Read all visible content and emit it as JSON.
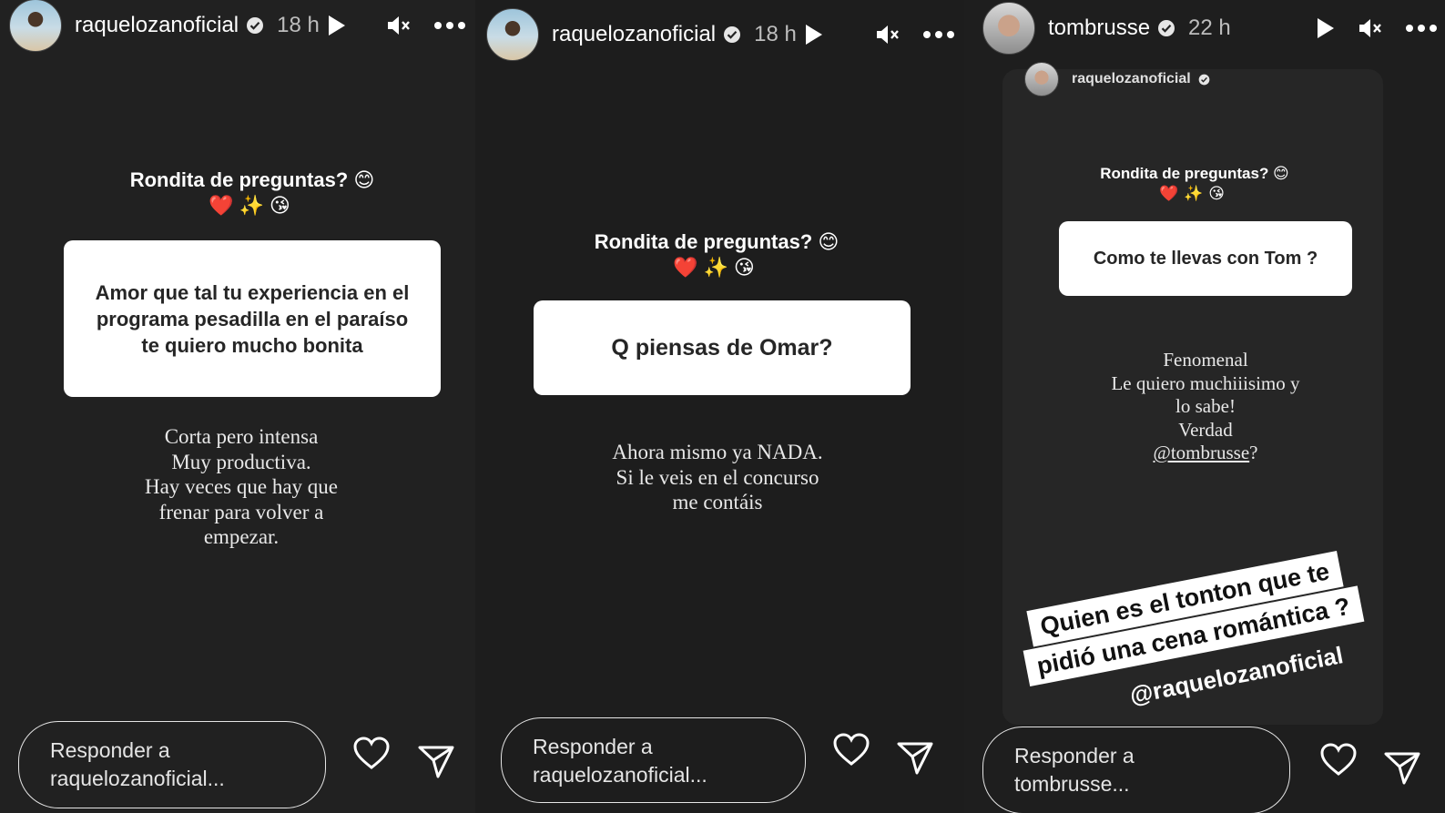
{
  "stories": [
    {
      "username": "raquelozanoficial",
      "time": "18 h",
      "sticker_title": "Rondita de preguntas? 😊",
      "sticker_emojis": "❤️✨😘",
      "question": "Amor que tal tu experiencia en el programa pesadilla en el paraíso te quiero mucho bonita",
      "answer_lines": [
        "Corta pero intensa",
        "Muy productiva.",
        "Hay veces que hay que",
        "frenar para volver a",
        "empezar."
      ],
      "reply_lines": [
        "Responder a",
        "raquelozanoficial..."
      ]
    },
    {
      "username": "raquelozanoficial",
      "time": "18 h",
      "sticker_title": "Rondita de preguntas? 😊",
      "sticker_emojis": "❤️✨😘",
      "question": "Q piensas de Omar?",
      "answer_lines": [
        "Ahora mismo ya NADA.",
        "Si le veis en el concurso",
        "me contáis"
      ],
      "reply_lines": [
        "Responder a",
        "raquelozanoficial..."
      ]
    },
    {
      "username": "tombrusse",
      "time": "22 h",
      "repost_username": "raquelozanoficial",
      "sticker_title": "Rondita de preguntas? 😊",
      "sticker_emojis": "❤️✨😘",
      "question": "Como te llevas con Tom ?",
      "answer_lines": [
        "Fenomenal",
        "Le quiero muchiiisimo y",
        "lo sabe!",
        "Verdad"
      ],
      "answer_mention": "@tombrusse",
      "answer_mention_suffix": "?",
      "caption_line1": "Quien es el tonton que te",
      "caption_line2": "pidió una cena romántica ?",
      "caption_mention": "@raquelozanoficial",
      "reply_lines": [
        "Responder a",
        "tombrusse..."
      ]
    }
  ],
  "icons": [
    "play-icon",
    "mute-icon",
    "more-icon",
    "verified-icon",
    "heart-icon",
    "send-icon"
  ],
  "colors": {
    "background": "#1f1f1f",
    "card": "#ffffff",
    "heart": "#e0245e"
  }
}
